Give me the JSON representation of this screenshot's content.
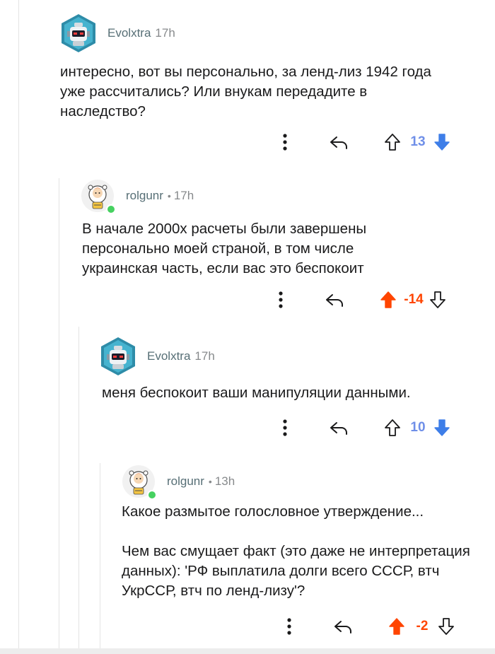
{
  "colors": {
    "upvote": "#ff4500",
    "downvote": "#3e7ee8",
    "score_down": "#6f8fe8",
    "online": "#46d160"
  },
  "comments": [
    {
      "author": "Evolxtra",
      "separator": "",
      "time": "17h",
      "avatar": "robot-avatar",
      "body": "интересно, вот вы персонально, за ленд-лиз 1942 года уже рассчитались? Или внукам передадите в наследство?",
      "score": "13",
      "vote_state": "downvoted"
    },
    {
      "author": "rolgunr",
      "separator": "•",
      "time": "17h",
      "avatar": "snowman-avatar",
      "body": "В начале 2000х расчеты были завершены персонально моей страной, в том числе украинская часть, если вас это беспокоит",
      "score": "-14",
      "vote_state": "upvoted"
    },
    {
      "author": "Evolxtra",
      "separator": "",
      "time": "17h",
      "avatar": "robot-avatar",
      "body": "меня беспокоит ваши манипуляции данными.",
      "score": "10",
      "vote_state": "downvoted"
    },
    {
      "author": "rolgunr",
      "separator": "•",
      "time": "13h",
      "avatar": "snowman-avatar",
      "body": "Какое размытое голословное утверждение...\n\nЧем вас смущает факт (это даже не интерпретация данных): 'РФ выплатила долги всего СССР, втч УкрССР, втч по ленд-лизу'?",
      "score": "-2",
      "vote_state": "upvoted"
    }
  ]
}
